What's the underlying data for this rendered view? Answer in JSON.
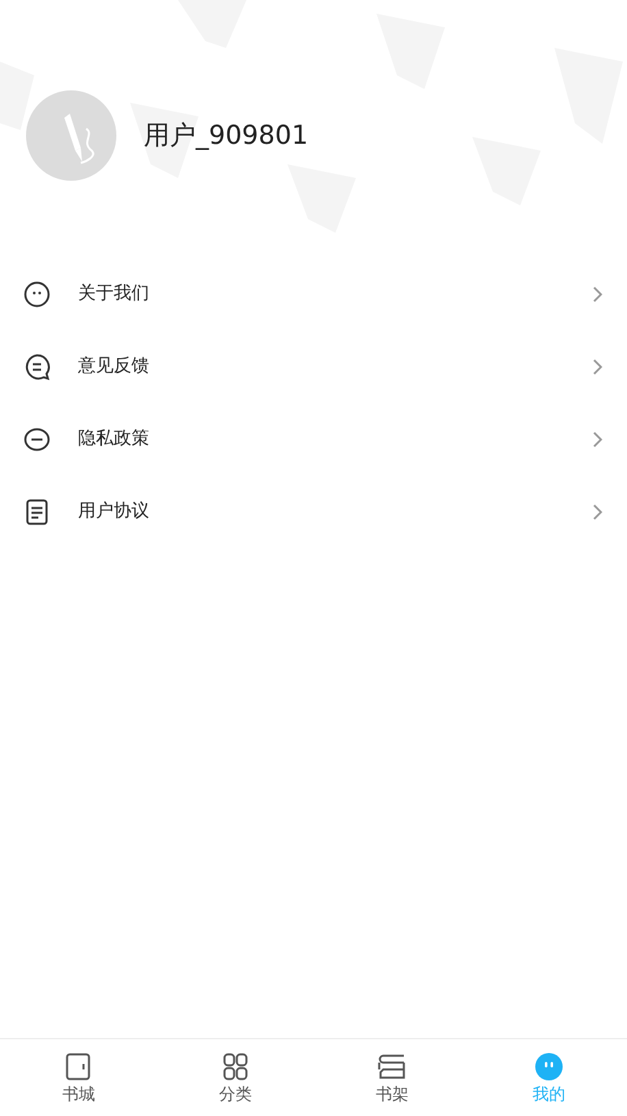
{
  "profile": {
    "username": "用户_909801"
  },
  "menu": [
    {
      "kind": "smile",
      "label": "关于我们"
    },
    {
      "kind": "chat",
      "label": "意见反馈"
    },
    {
      "kind": "minus",
      "label": "隐私政策"
    },
    {
      "kind": "doc",
      "label": "用户协议"
    }
  ],
  "tabs": [
    {
      "kind": "book",
      "label": "书城",
      "selected": false
    },
    {
      "kind": "grid",
      "label": "分类",
      "selected": false
    },
    {
      "kind": "shelf",
      "label": "书架",
      "selected": false
    },
    {
      "kind": "me",
      "label": "我的",
      "selected": true
    }
  ]
}
